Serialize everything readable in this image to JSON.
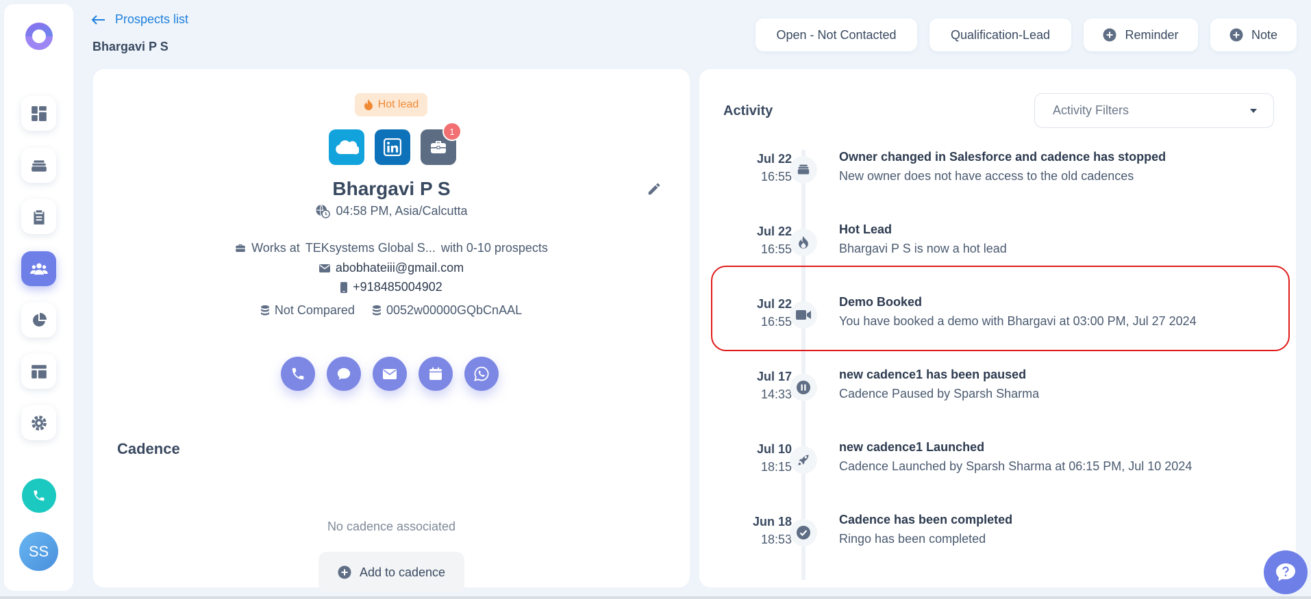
{
  "header": {
    "back_label": "Prospects list",
    "page_title": "Bhargavi P S",
    "status_buttons": [
      {
        "label": "Open - Not Contacted"
      },
      {
        "label": "Qualification-Lead"
      },
      {
        "label": "Reminder",
        "icon": "plus-circle-icon"
      },
      {
        "label": "Note",
        "icon": "plus-circle-icon"
      }
    ]
  },
  "sidebar": {
    "items": [
      {
        "name": "dashboard",
        "icon": "dashboard-grid-icon",
        "active": false
      },
      {
        "name": "cadences",
        "icon": "stack-icon",
        "active": false
      },
      {
        "name": "tasks",
        "icon": "clipboard-icon",
        "active": false
      },
      {
        "name": "people",
        "icon": "people-icon",
        "active": true
      },
      {
        "name": "reports",
        "icon": "pie-chart-icon",
        "active": false
      },
      {
        "name": "templates",
        "icon": "layout-icon",
        "active": false
      },
      {
        "name": "settings",
        "icon": "gear-icon",
        "active": false
      }
    ],
    "avatar_initials": "SS"
  },
  "profile": {
    "badge": "Hot lead",
    "notification_count": "1",
    "name": "Bhargavi P S",
    "time": "04:58 PM, Asia/Calcutta",
    "works_prefix": "Works at",
    "company": "TEKsystems Global S...",
    "prospects": "with 0-10 prospects",
    "email": "abobhateiii@gmail.com",
    "phone": "+918485004902",
    "compare_status": "Not Compared",
    "salesforce_id": "0052w00000GQbCnAAL"
  },
  "cadence": {
    "title": "Cadence",
    "empty_text": "No cadence associated",
    "add_label": "Add to cadence"
  },
  "activity": {
    "title": "Activity",
    "filter_placeholder": "Activity Filters",
    "events": [
      {
        "date": "Jul 22",
        "time": "16:55",
        "title": "Owner changed in Salesforce and cadence has stopped",
        "desc": "New owner does not have access to the old cadences",
        "icon": "stack-icon"
      },
      {
        "date": "Jul 22",
        "time": "16:55",
        "title": "Hot Lead",
        "desc": "Bhargavi P S is now a hot lead",
        "icon": "flame-icon"
      },
      {
        "date": "Jul 22",
        "time": "16:55",
        "title": "Demo Booked",
        "desc": "You have booked a demo with Bhargavi at 03:00 PM, Jul 27 2024",
        "icon": "video-camera-icon"
      },
      {
        "date": "Jul 17",
        "time": "14:33",
        "title": "new cadence1 has been paused",
        "desc": "Cadence Paused by Sparsh Sharma",
        "icon": "pause-icon"
      },
      {
        "date": "Jul 10",
        "time": "18:15",
        "title": "new cadence1 Launched",
        "desc": "Cadence Launched by Sparsh Sharma at 06:15 PM, Jul 10 2024",
        "icon": "rocket-icon"
      },
      {
        "date": "Jun 18",
        "time": "18:53",
        "title": "Cadence has been completed",
        "desc": "Ringo has been completed",
        "icon": "check-circle-icon"
      }
    ]
  },
  "colors": {
    "accent": "#6f7fe8",
    "link": "#1d7fde",
    "hot": "#f08a35",
    "highlight": "#e01a1a"
  }
}
